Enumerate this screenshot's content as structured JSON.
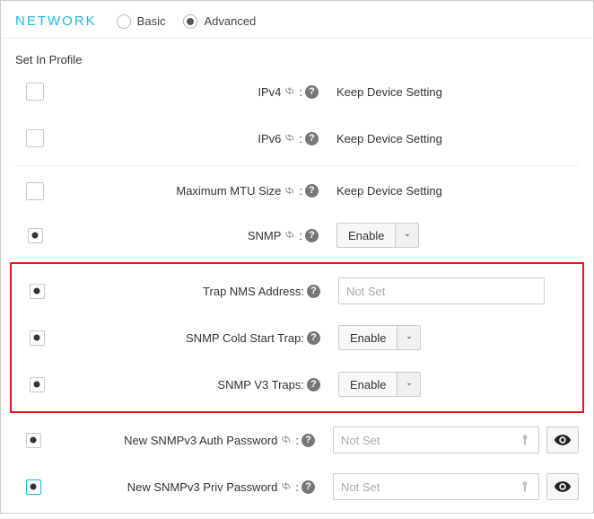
{
  "header": {
    "title": "NETWORK",
    "mode_basic": "Basic",
    "mode_advanced": "Advanced",
    "mode_selected": "advanced"
  },
  "section_label": "Set In Profile",
  "help_glyph": "?",
  "rows": {
    "ipv4": {
      "label": "IPv4",
      "value": "Keep Device Setting"
    },
    "ipv6": {
      "label": "IPv6",
      "value": "Keep Device Setting"
    },
    "mtu": {
      "label": "Maximum MTU Size",
      "value": "Keep Device Setting"
    },
    "snmp": {
      "label": "SNMP",
      "btn": "Enable"
    },
    "trap_addr": {
      "label": "Trap NMS Address:",
      "placeholder": "Not Set"
    },
    "cold_start": {
      "label": "SNMP Cold Start Trap:",
      "btn": "Enable"
    },
    "v3_traps": {
      "label": "SNMP V3 Traps:",
      "btn": "Enable"
    },
    "auth_pw": {
      "label": "New SNMPv3 Auth Password",
      "placeholder": "Not Set"
    },
    "priv_pw": {
      "label": "New SNMPv3 Priv Password",
      "placeholder": "Not Set"
    }
  }
}
